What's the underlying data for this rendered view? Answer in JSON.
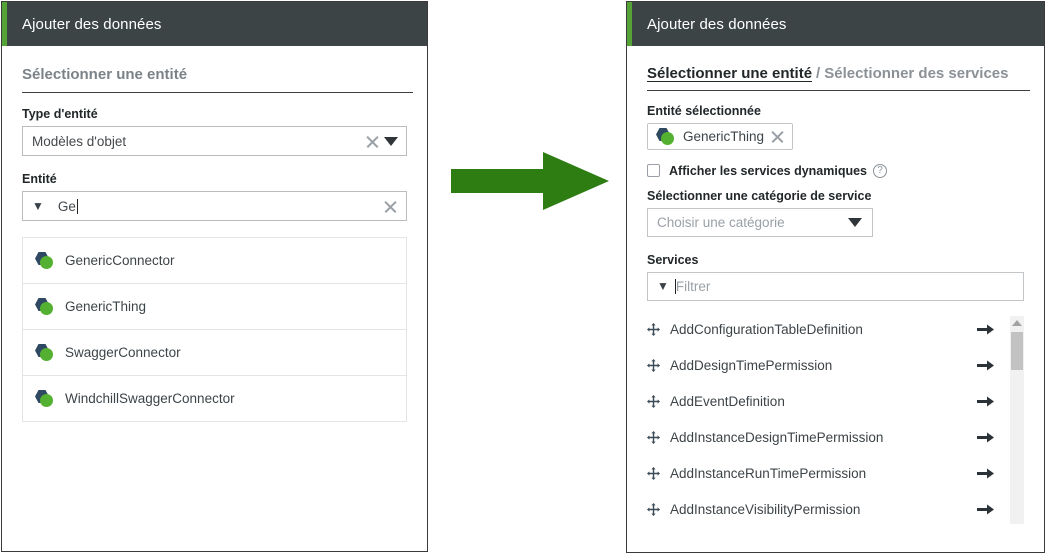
{
  "colors": {
    "titlebar_bg": "#3c4446",
    "titlebar_accent": "#55a336",
    "arrow_green": "#2d7d13",
    "entity_icon_hex": "#2e4961",
    "entity_icon_dot": "#54b030",
    "heading_gray": "#7b8288",
    "text_dark": "#22272a",
    "placeholder_gray": "#9aa0a6"
  },
  "left_panel": {
    "titlebar": {
      "title": "Ajouter des données"
    },
    "section_heading": "Sélectionner une entité",
    "entity_type": {
      "label": "Type d'entité",
      "value": "Modèles d'objet",
      "clear_icon": "close-x-icon",
      "dropdown_icon": "caret-down-icon"
    },
    "entity": {
      "label": "Entité",
      "value": "Ge",
      "filter_icon": "filter-funnel-icon",
      "clear_icon": "close-x-icon"
    },
    "results": [
      {
        "label": "GenericConnector",
        "icon": "thing-entity-icon"
      },
      {
        "label": "GenericThing",
        "icon": "thing-entity-icon"
      },
      {
        "label": "SwaggerConnector",
        "icon": "thing-entity-icon"
      },
      {
        "label": "WindchillSwaggerConnector",
        "icon": "thing-entity-icon"
      }
    ]
  },
  "arrow": {
    "icon": "arrow-right-green-icon"
  },
  "right_panel": {
    "titlebar": {
      "title": "Ajouter des données"
    },
    "breadcrumb": {
      "active": "Sélectionner une entité",
      "separator": "/",
      "next": "Sélectionner des services"
    },
    "selected_entity": {
      "label": "Entité sélectionnée",
      "chip_name": "GenericThing",
      "chip_icon": "thing-entity-icon",
      "remove_icon": "close-x-icon"
    },
    "dynamic_services": {
      "checkbox_label": "Afficher les services dynamiques",
      "checked": false,
      "help_icon": "question-mark-icon",
      "help_glyph": "?"
    },
    "service_category": {
      "label": "Sélectionner une catégorie de service",
      "placeholder": "Choisir une catégorie",
      "dropdown_icon": "caret-down-icon"
    },
    "services": {
      "label": "Services",
      "filter_placeholder": "Filtrer",
      "filter_icon": "filter-funnel-icon",
      "items": [
        {
          "name": "AddConfigurationTableDefinition",
          "drag_icon": "move-arrows-icon",
          "action_icon": "arrow-right-icon"
        },
        {
          "name": "AddDesignTimePermission",
          "drag_icon": "move-arrows-icon",
          "action_icon": "arrow-right-icon"
        },
        {
          "name": "AddEventDefinition",
          "drag_icon": "move-arrows-icon",
          "action_icon": "arrow-right-icon"
        },
        {
          "name": "AddInstanceDesignTimePermission",
          "drag_icon": "move-arrows-icon",
          "action_icon": "arrow-right-icon"
        },
        {
          "name": "AddInstanceRunTimePermission",
          "drag_icon": "move-arrows-icon",
          "action_icon": "arrow-right-icon"
        },
        {
          "name": "AddInstanceVisibilityPermission",
          "drag_icon": "move-arrows-icon",
          "action_icon": "arrow-right-icon"
        }
      ],
      "scrollbar": {
        "up_icon": "scroll-up-arrow-icon"
      }
    }
  }
}
